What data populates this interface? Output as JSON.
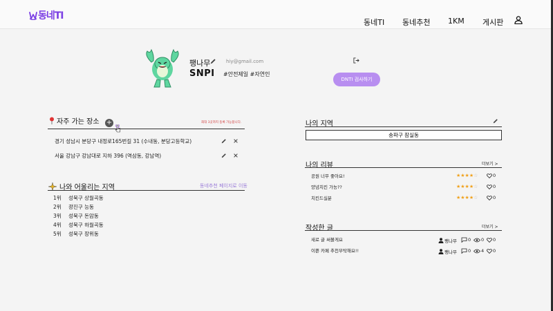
{
  "header": {
    "logo_text": "동네TI",
    "nav": [
      "동네TI",
      "동네추천",
      "1KM",
      "게시판"
    ]
  },
  "profile": {
    "nickname": "팽나무",
    "email": "hiy@gmail.com",
    "type_code": "SNPI",
    "type_tags": "#안전제일 #자연인",
    "test_button": "DNTI 검사하기"
  },
  "favorites": {
    "title": "자주 가는 장소",
    "notice": "최대 3곳까지 등록 가능합니다.",
    "places": [
      "경기 성남시 분당구 내정로165번길 31 (수내동, 분당고등학교)",
      "서울 강남구 강남대로 지하 396 (역삼동, 강남역)"
    ]
  },
  "matching": {
    "title": "나와 어울리는 지역",
    "link": "동네추천 페이지로 이동",
    "ranks": [
      {
        "rank": "1위",
        "name": "성북구 상월곡동"
      },
      {
        "rank": "2위",
        "name": "광진구 능동"
      },
      {
        "rank": "3위",
        "name": "성북구 돈암동"
      },
      {
        "rank": "4위",
        "name": "성북구 하월곡동"
      },
      {
        "rank": "5위",
        "name": "성북구 장위동"
      }
    ]
  },
  "my_region": {
    "title": "나의 지역",
    "value": "송파구 잠실동"
  },
  "reviews": {
    "title": "나의 리뷰",
    "more": "더보기 >",
    "items": [
      {
        "text": "공원 너무 좋아요!",
        "rating": 4,
        "likes": "0"
      },
      {
        "text": "양념치킨 가능??",
        "rating": 4,
        "likes": "0"
      },
      {
        "text": "치킨드실분",
        "rating": 4,
        "likes": "0"
      }
    ]
  },
  "posts": {
    "title": "작성한 글",
    "more": "더보기 >",
    "items": [
      {
        "title": "새로 글 써볼게요",
        "author": "팽나무",
        "comments": "0",
        "views": "0",
        "likes": "0"
      },
      {
        "title": "이쁜 카페 추천부탁해요!!",
        "author": "팽나무",
        "comments": "0",
        "views": "4",
        "likes": "0"
      }
    ]
  },
  "colors": {
    "accent": "#7b3fe4",
    "button": "#b88ef0",
    "star": "#f0a21e",
    "notice": "#d13b3b"
  }
}
